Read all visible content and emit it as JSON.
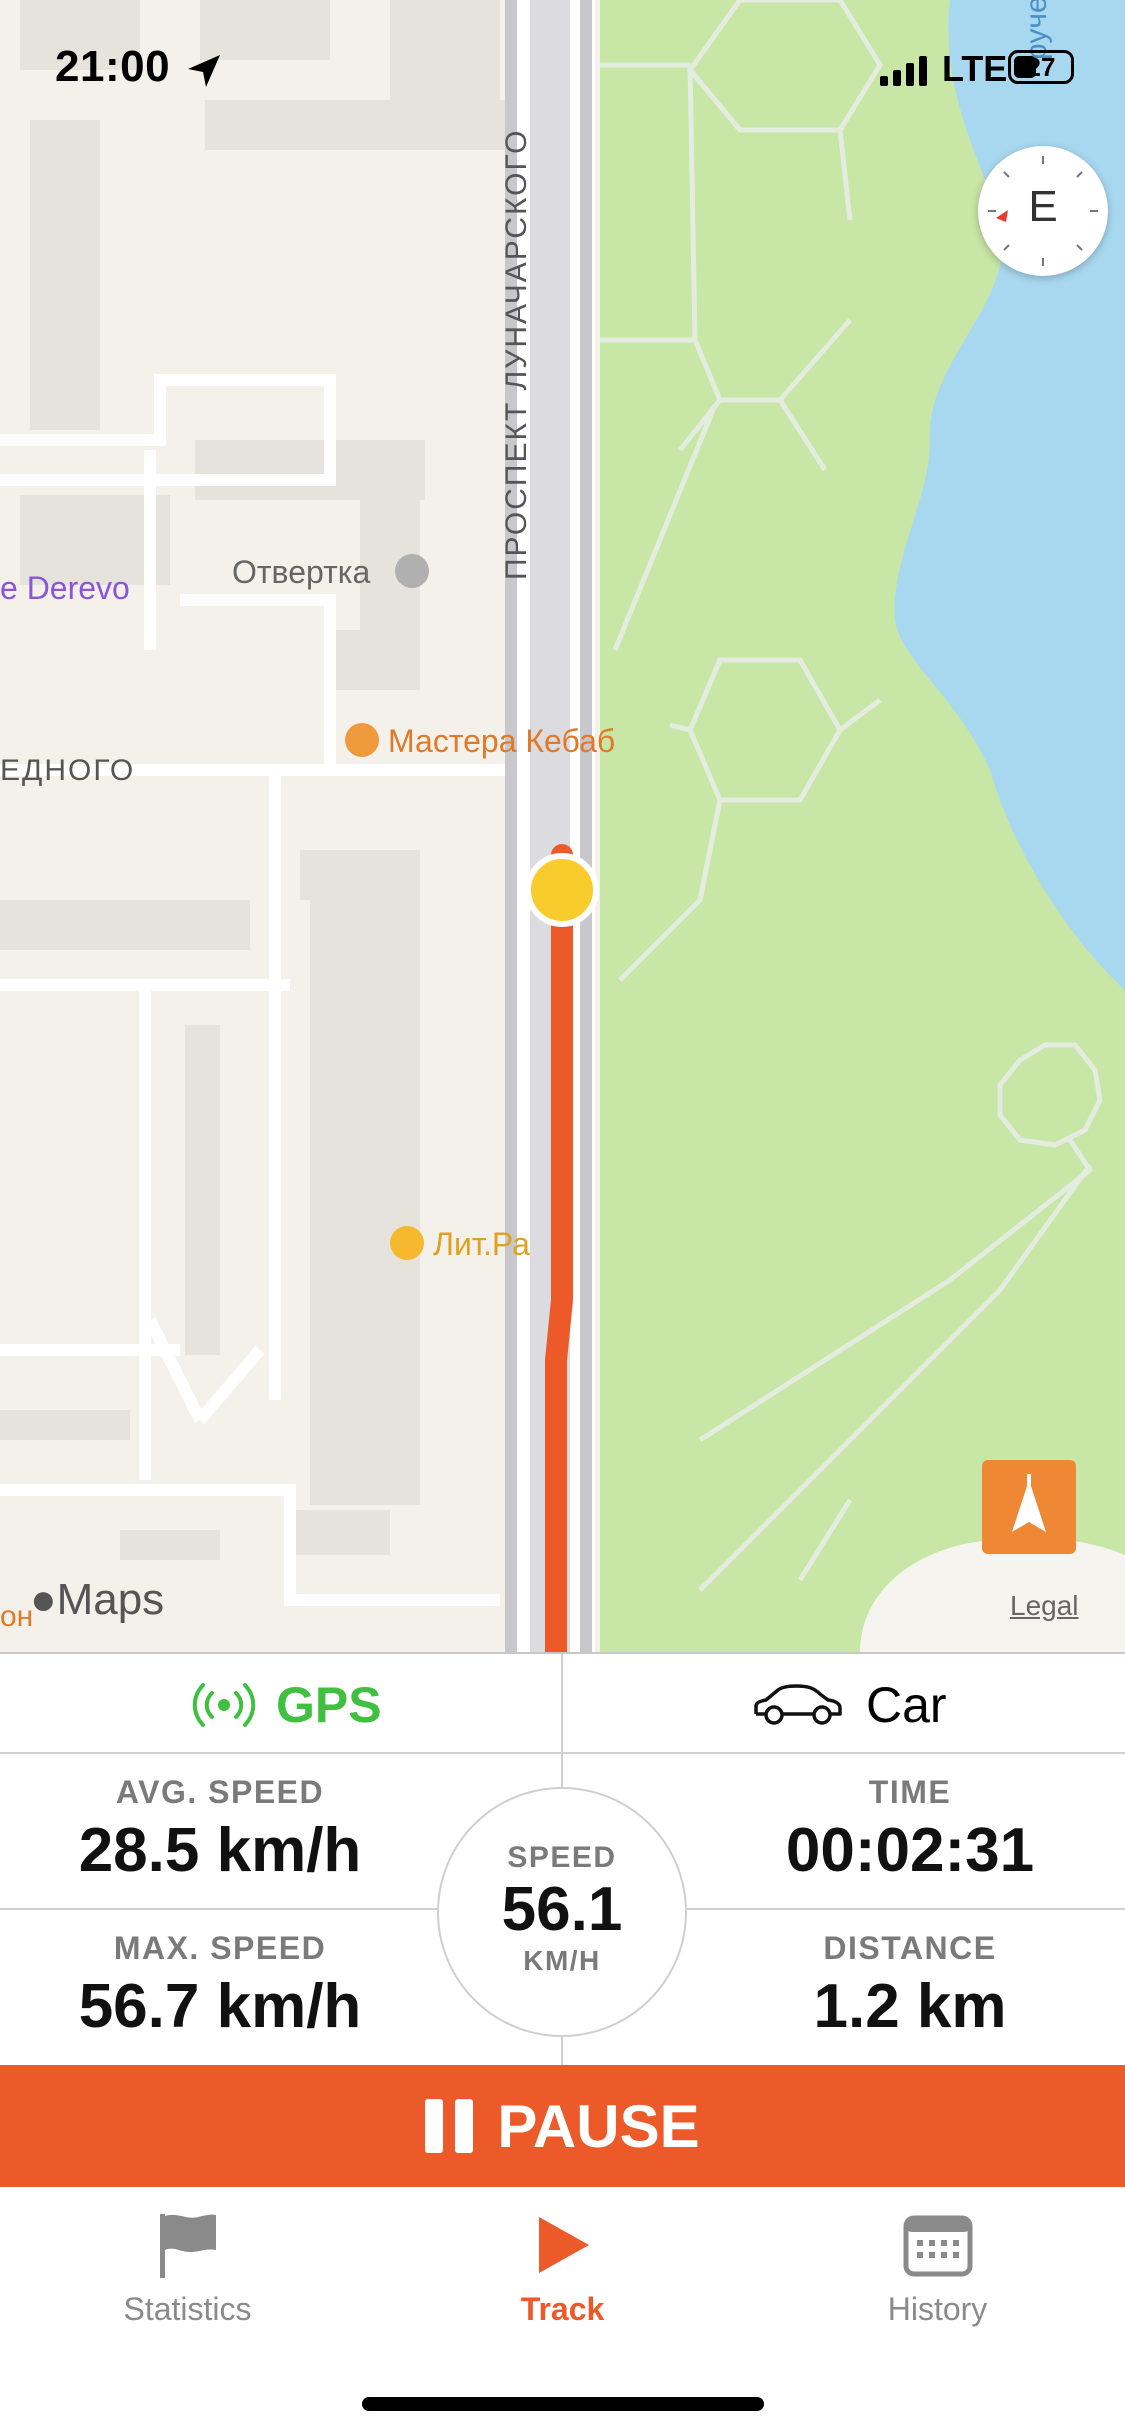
{
  "status_bar": {
    "time": "21:00",
    "network": "LTE",
    "battery": "27"
  },
  "map": {
    "compass_label": "E",
    "street_main": "ПРОСПЕКТ ЛУНАЧАРСКОГО",
    "street_cross": "ЕДНОГО",
    "poi_derevo": "e Derevo",
    "poi_otvertka": "Отвертка",
    "poi_kebab": "Мастера Кебаб",
    "poi_litra": "Лит.Ра",
    "poi_river": "ручей",
    "poi_edge": "он",
    "maps_label": "Maps",
    "legal": "Legal"
  },
  "status_row": {
    "gps_label": "GPS",
    "vehicle_label": "Car"
  },
  "stats": {
    "avg_speed_label": "AVG. SPEED",
    "avg_speed": "28.5 km/h",
    "time_label": "TIME",
    "time": "00:02:31",
    "max_speed_label": "MAX. SPEED",
    "max_speed": "56.7 km/h",
    "distance_label": "DISTANCE",
    "distance": "1.2 km",
    "speed_label": "SPEED",
    "speed": "56.1",
    "speed_unit": "KM/H"
  },
  "pause_label": "PAUSE",
  "tabs": [
    {
      "label": "Statistics",
      "icon": "flag-icon",
      "active": false
    },
    {
      "label": "Track",
      "icon": "play-icon",
      "active": true
    },
    {
      "label": "History",
      "icon": "calendar-icon",
      "active": false
    }
  ],
  "colors": {
    "accent": "#ec5a2a",
    "gps_green": "#40c040",
    "park_green": "#c8e6a5",
    "water": "#a8d8f0",
    "route": "#ec5a2a",
    "position_dot": "#f8cc2c"
  }
}
